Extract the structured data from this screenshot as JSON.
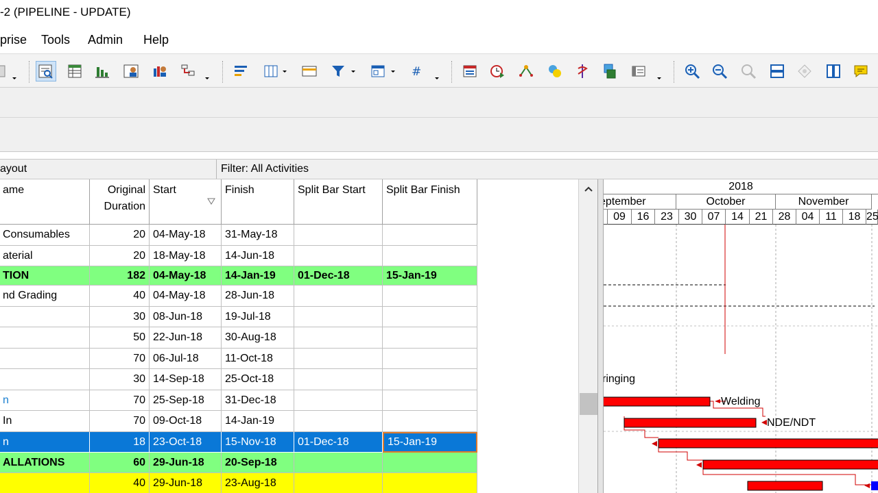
{
  "window": {
    "title": "-2 (PIPELINE - UPDATE)"
  },
  "menu": {
    "items": [
      "prise",
      "Tools",
      "Admin",
      "Help"
    ]
  },
  "infobar": {
    "layout": "ayout",
    "filter": "Filter: All Activities"
  },
  "columns": {
    "name": "ame",
    "original_duration_1": "Original",
    "original_duration_2": "Duration",
    "start": "Start",
    "finish": "Finish",
    "split_bar_start": "Split Bar Start",
    "split_bar_finish": "Split Bar Finish"
  },
  "rows": [
    {
      "name": "Consumables",
      "duration": "20",
      "start": "04-May-18",
      "finish": "31-May-18",
      "split_start": "",
      "split_finish": "",
      "style": "normal",
      "bg": "#ffffff"
    },
    {
      "name": "aterial",
      "duration": "20",
      "start": "18-May-18",
      "finish": "14-Jun-18",
      "split_start": "",
      "split_finish": "",
      "style": "normal",
      "bg": "#ffffff"
    },
    {
      "name": "TION",
      "duration": "182",
      "start": "04-May-18",
      "finish": "14-Jan-19",
      "split_start": "01-Dec-18",
      "split_finish": "15-Jan-19",
      "style": "bold",
      "bg": "#80ff80"
    },
    {
      "name": "nd Grading",
      "duration": "40",
      "start": "04-May-18",
      "finish": "28-Jun-18",
      "split_start": "",
      "split_finish": "",
      "style": "normal",
      "bg": "#ffffff"
    },
    {
      "name": "",
      "duration": "30",
      "start": "08-Jun-18",
      "finish": "19-Jul-18",
      "split_start": "",
      "split_finish": "",
      "style": "normal",
      "bg": "#ffffff"
    },
    {
      "name": "",
      "duration": "50",
      "start": "22-Jun-18",
      "finish": "30-Aug-18",
      "split_start": "",
      "split_finish": "",
      "style": "normal",
      "bg": "#ffffff"
    },
    {
      "name": "",
      "duration": "70",
      "start": "06-Jul-18",
      "finish": "11-Oct-18",
      "split_start": "",
      "split_finish": "",
      "style": "normal",
      "bg": "#ffffff"
    },
    {
      "name": "",
      "duration": "30",
      "start": "14-Sep-18",
      "finish": "25-Oct-18",
      "split_start": "",
      "split_finish": "",
      "style": "normal",
      "bg": "#ffffff"
    },
    {
      "name": "n",
      "duration": "70",
      "start": "25-Sep-18",
      "finish": "31-Dec-18",
      "split_start": "",
      "split_finish": "",
      "style": "link",
      "bg": "#ffffff"
    },
    {
      "name": "In",
      "duration": "70",
      "start": "09-Oct-18",
      "finish": "14-Jan-19",
      "split_start": "",
      "split_finish": "",
      "style": "normal",
      "bg": "#ffffff"
    },
    {
      "name": "n",
      "duration": "18",
      "start": "23-Oct-18",
      "finish": "15-Nov-18",
      "split_start": "01-Dec-18",
      "split_finish": "15-Jan-19",
      "style": "selected",
      "bg": "#0a78d7"
    },
    {
      "name": "ALLATIONS",
      "duration": "60",
      "start": "29-Jun-18",
      "finish": "20-Sep-18",
      "split_start": "",
      "split_finish": "",
      "style": "bold",
      "bg": "#80ff80"
    },
    {
      "name": "",
      "duration": "40",
      "start": "29-Jun-18",
      "finish": "23-Aug-18",
      "split_start": "",
      "split_finish": "",
      "style": "normal",
      "bg": "#ffff00"
    }
  ],
  "gantt": {
    "year": "2018",
    "months": [
      "eptember",
      "October",
      "November"
    ],
    "days": [
      "09",
      "16",
      "23",
      "30",
      "07",
      "14",
      "21",
      "28",
      "04",
      "11",
      "18",
      "25"
    ],
    "labels": {
      "stringing": "ringing",
      "welding": "Welding",
      "nde": "NDE/NDT"
    },
    "bar_color": "#ff0000",
    "link_color": "#d00000",
    "split_color": "#0000ff"
  },
  "toolbar_icons": [
    "layout-dropdown-icon",
    "activities-icon",
    "wbs-icon",
    "tracking-icon",
    "resource-assignments-icon",
    "resource-usage-icon",
    "wbs-move-icon",
    "bars-icon",
    "columns-icon",
    "table-icon",
    "filter-icon",
    "layout-options-icon",
    "hash-icon",
    "activity-details-icon",
    "schedule-icon",
    "level-icon",
    "summarize-icon",
    "critical-path-icon",
    "store-period-icon",
    "reports-icon",
    "zoom-in-icon",
    "zoom-out-icon",
    "zoom-fit-icon",
    "split-horizontal-icon",
    "diamond-icon",
    "split-vertical-icon",
    "notebook-icon"
  ]
}
